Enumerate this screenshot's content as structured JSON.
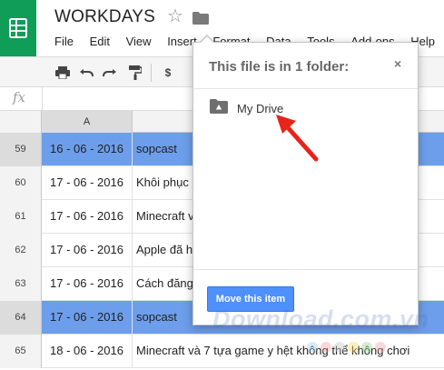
{
  "header": {
    "title": "WORKDAYS",
    "star_icon": "star-outline-icon",
    "folder_icon": "folder-icon"
  },
  "menu": [
    "File",
    "Edit",
    "View",
    "Insert",
    "Format",
    "Data",
    "Tools",
    "Add-ons",
    "Help"
  ],
  "toolbar": {
    "icons": [
      "print-icon",
      "undo-icon",
      "redo-icon",
      "paint-format-icon",
      "currency-icon"
    ],
    "currency_label": "$"
  },
  "formula_bar": {
    "fx_label": "fx"
  },
  "grid": {
    "column_a_label": "A",
    "rows": [
      {
        "num": "59",
        "date": "16 - 06 - 2016",
        "text": "sopcast",
        "selected": true
      },
      {
        "num": "60",
        "date": "17 - 06 - 2016",
        "text": "Khôi phục",
        "selected": false
      },
      {
        "num": "61",
        "date": "17 - 06 - 2016",
        "text": "Minecraft v",
        "selected": false
      },
      {
        "num": "62",
        "date": "17 - 06 - 2016",
        "text": "Apple đã h",
        "selected": false
      },
      {
        "num": "63",
        "date": "17 - 06 - 2016",
        "text": "Cách đăng",
        "selected": false
      },
      {
        "num": "64",
        "date": "17 - 06 - 2016",
        "text": "sopcast",
        "selected": true
      },
      {
        "num": "65",
        "date": "18 - 06 - 2016",
        "text": "Minecraft và 7 tựa game y hệt không thể không chơi",
        "selected": false
      }
    ]
  },
  "popup": {
    "title": "This file is in 1 folder:",
    "close_label": "×",
    "folder_name": "My Drive",
    "move_button_label": "Move this item"
  },
  "colors": {
    "brand_green": "#0f9d58",
    "selection_blue": "#6d9eeb",
    "button_blue": "#4d90fe",
    "annotation_red": "#e8231a"
  },
  "watermark": {
    "text": "Download.com.vn"
  }
}
